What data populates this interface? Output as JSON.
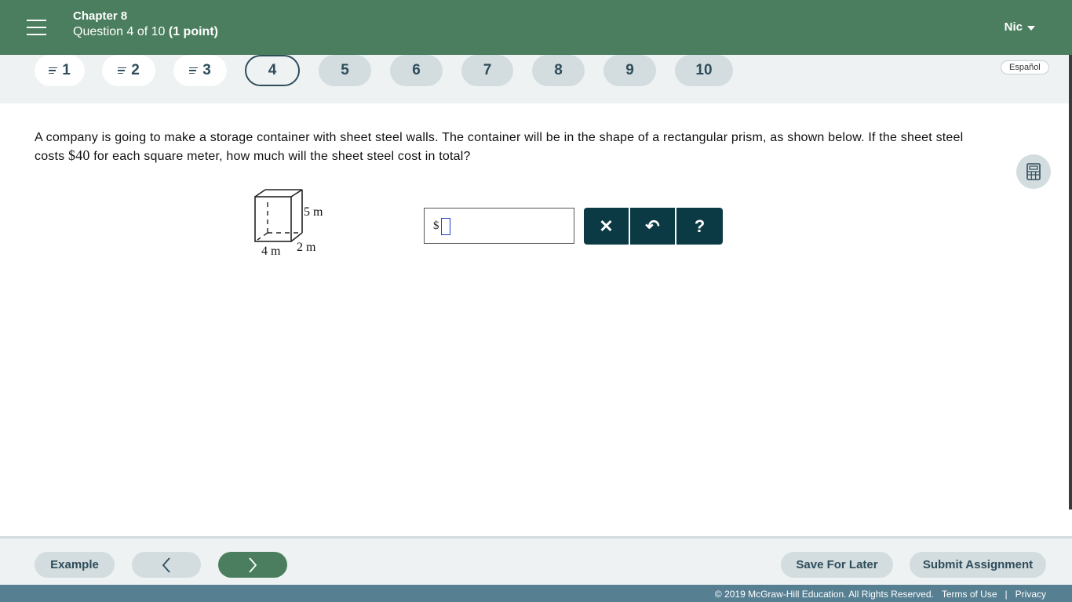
{
  "header": {
    "chapter": "Chapter 8",
    "question_prefix": "Question 4 of 10",
    "points": "(1 point)",
    "user_name": "Nic"
  },
  "question_nav": {
    "items": [
      "1",
      "2",
      "3",
      "4",
      "5",
      "6",
      "7",
      "8",
      "9",
      "10"
    ],
    "completed": [
      1,
      2,
      3
    ],
    "current": 4,
    "language_label": "Español"
  },
  "question": {
    "text_before_amount": "A company is going to make a storage container with sheet steel walls. The container will be in the shape of a rectangular prism, as shown below. If the sheet steel costs ",
    "amount": "$40",
    "text_after_amount": " for each square meter, how much will the sheet steel cost in total?",
    "figure": {
      "height_label": "5 m",
      "width_label": "4 m",
      "depth_label": "2 m"
    },
    "answer": {
      "prefix": "$",
      "value": ""
    }
  },
  "answer_tools": {
    "clear_label": "✕",
    "undo_label": "↶",
    "help_label": "?"
  },
  "footer": {
    "example_label": "Example",
    "prev_label": "<",
    "next_label": ">",
    "save_label": "Save For Later",
    "submit_label": "Submit Assignment"
  },
  "copyright": {
    "text": "© 2019 McGraw-Hill Education. All Rights Reserved.",
    "terms": "Terms of Use",
    "separator": "|",
    "privacy": "Privacy"
  },
  "colors": {
    "header_green": "#4a7e5e",
    "tool_dark": "#0b3a45",
    "copybar_blue": "#577f92",
    "pill_gray": "#d3dcdf"
  }
}
